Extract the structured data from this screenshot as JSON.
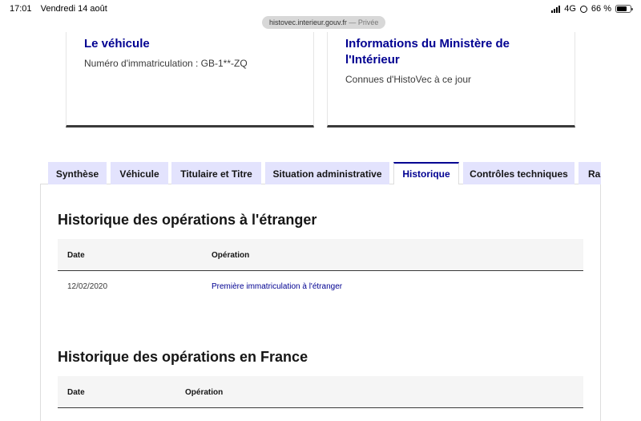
{
  "status_bar": {
    "time": "17:01",
    "date": "Vendredi 14 août",
    "network": "4G",
    "battery": "66 %",
    "battery_level": 0.66
  },
  "browser": {
    "url": "histovec.interieur.gouv.fr",
    "mode": "— Privée"
  },
  "cards": [
    {
      "title": "Le véhicule",
      "text": "Numéro d'immatriculation : GB-1**-ZQ"
    },
    {
      "title_line1": "Informations du Ministère de",
      "title_line2": "l'Intérieur",
      "text": "Connues d'HistoVec à ce jour"
    }
  ],
  "tabs": [
    {
      "label": "Synthèse"
    },
    {
      "label": "Véhicule"
    },
    {
      "label": "Titulaire et Titre"
    },
    {
      "label": "Situation administrative"
    },
    {
      "label": "Historique"
    },
    {
      "label": "Contrôles techniques"
    },
    {
      "label": "Rap"
    }
  ],
  "active_tab": "Historique",
  "sections": [
    {
      "title": "Historique des opérations à l'étranger",
      "columns": [
        "Date",
        "Opération"
      ],
      "rows": [
        {
          "date": "12/02/2020",
          "operation": "Première immatriculation à l'étranger"
        }
      ]
    },
    {
      "title": "Historique des opérations en France",
      "columns": [
        "Date",
        "Opération"
      ],
      "rows": []
    }
  ],
  "colors": {
    "accent": "#000091",
    "tab_bg": "#e3e3fd",
    "header_bg": "#f5f5f5"
  }
}
